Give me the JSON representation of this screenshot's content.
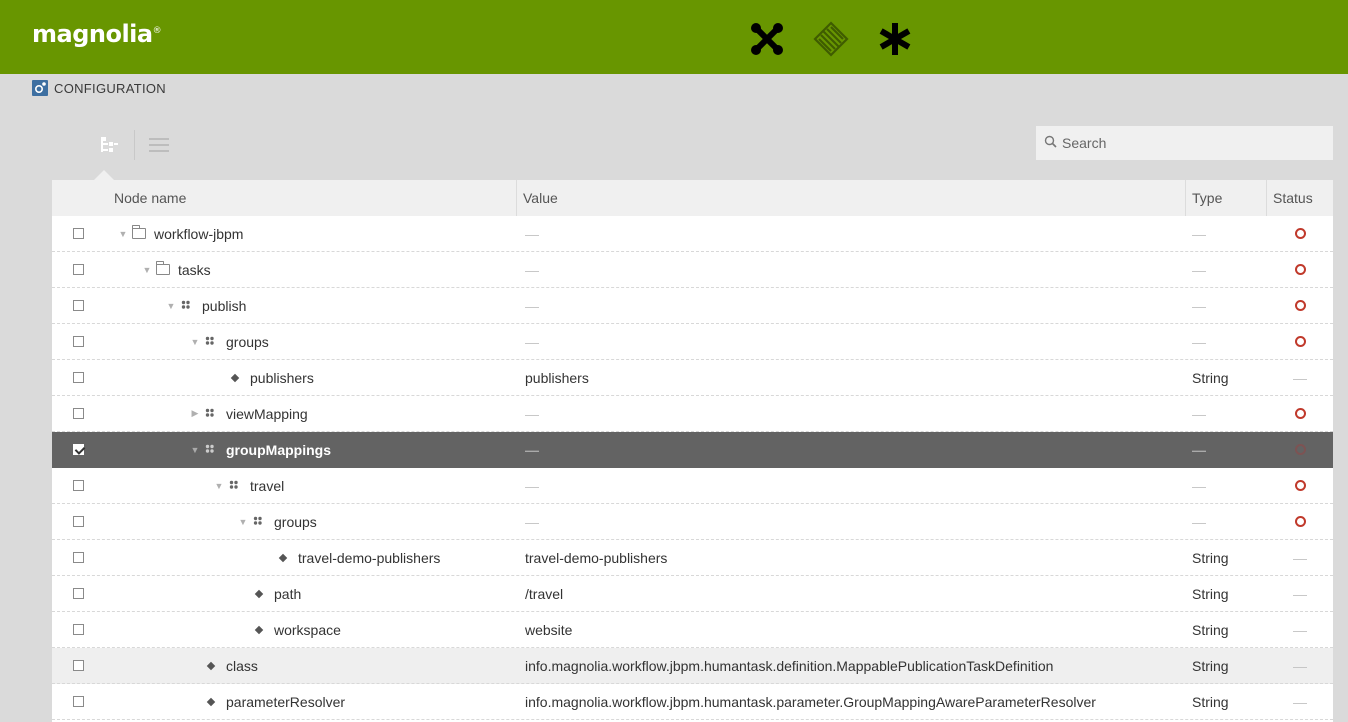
{
  "header": {
    "logo_text": "magnolia",
    "logo_mark": "®",
    "apps": [
      {
        "icon": "cross-nodes-icon"
      },
      {
        "icon": "diamond-lines-icon"
      },
      {
        "icon": "asterisk-icon"
      }
    ]
  },
  "breadcrumb": {
    "icon": "configuration-icon",
    "label": "CONFIGURATION"
  },
  "toolbar": {
    "tree_view_icon": "tree-view-icon",
    "list_view_icon": "list-view-icon",
    "search_placeholder": "Search"
  },
  "table": {
    "columns": {
      "name": "Node name",
      "value": "Value",
      "type": "Type",
      "status": "Status"
    },
    "rows": [
      {
        "name": "workflow-jbpm",
        "value": "—",
        "type": "—",
        "status": "○"
      },
      {
        "name": "tasks",
        "value": "—",
        "type": "—",
        "status": "○"
      },
      {
        "name": "publish",
        "value": "—",
        "type": "—",
        "status": "○"
      },
      {
        "name": "groups",
        "value": "—",
        "type": "—",
        "status": "○"
      },
      {
        "name": "publishers",
        "value": "publishers",
        "type": "String",
        "status": "—"
      },
      {
        "name": "viewMapping",
        "value": "—",
        "type": "—",
        "status": "○"
      },
      {
        "name": "groupMappings",
        "value": "—",
        "type": "—",
        "status": "○"
      },
      {
        "name": "travel",
        "value": "—",
        "type": "—",
        "status": "○"
      },
      {
        "name": "groups",
        "value": "—",
        "type": "—",
        "status": "○"
      },
      {
        "name": "travel-demo-publishers",
        "value": "travel-demo-publishers",
        "type": "String",
        "status": "—"
      },
      {
        "name": "path",
        "value": "/travel",
        "type": "String",
        "status": "—"
      },
      {
        "name": "workspace",
        "value": "website",
        "type": "String",
        "status": "—"
      },
      {
        "name": "class",
        "value": "info.magnolia.workflow.jbpm.humantask.definition.MappablePublicationTaskDefinition",
        "type": "String",
        "status": "—"
      },
      {
        "name": "parameterResolver",
        "value": "info.magnolia.workflow.jbpm.humantask.parameter.GroupMappingAwareParameterResolver",
        "type": "String",
        "status": "—"
      }
    ]
  },
  "colors": {
    "header_green": "#689600",
    "selected_row": "#636363",
    "status_red": "#c0392b"
  }
}
